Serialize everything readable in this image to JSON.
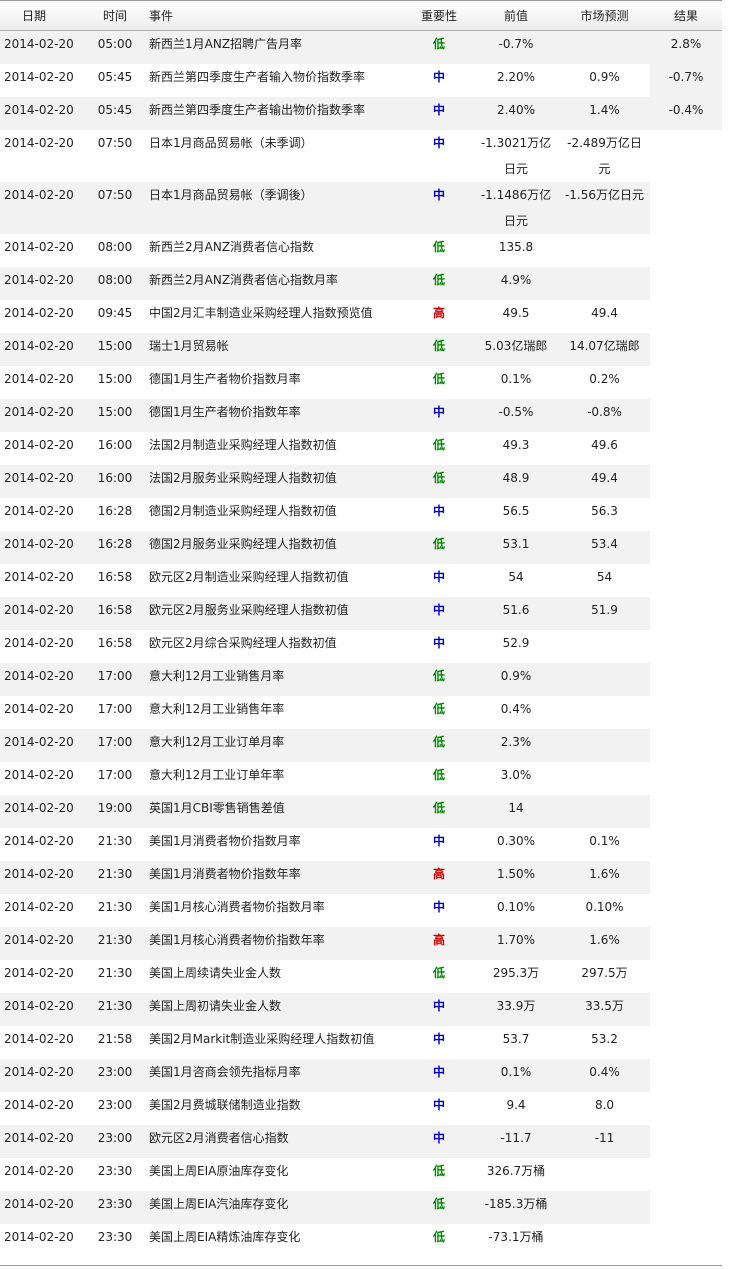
{
  "headers": {
    "date": "日期",
    "time": "时间",
    "event": "事件",
    "importance": "重要性",
    "previous": "前值",
    "forecast": "市场预测",
    "result": "结果"
  },
  "importance_colors": {
    "低": "#008800",
    "中": "#0000aa",
    "高": "#cc0000"
  },
  "rows": [
    {
      "date": "2014-02-20",
      "time": "05:00",
      "event": "新西兰1月ANZ招聘广告月率",
      "importance": "低",
      "previous": "-0.7%",
      "forecast": "",
      "result": "2.8%"
    },
    {
      "date": "2014-02-20",
      "time": "05:45",
      "event": "新西兰第四季度生产者输入物价指数季率",
      "importance": "中",
      "previous": "2.20%",
      "forecast": "0.9%",
      "result": "-0.7%"
    },
    {
      "date": "2014-02-20",
      "time": "05:45",
      "event": "新西兰第四季度生产者输出物价指数季率",
      "importance": "中",
      "previous": "2.40%",
      "forecast": "1.4%",
      "result": "-0.4%"
    },
    {
      "date": "2014-02-20",
      "time": "07:50",
      "event": "日本1月商品贸易帐（未季调）",
      "importance": "中",
      "previous": "-1.3021万亿日元",
      "forecast": "-2.489万亿日元",
      "result": ""
    },
    {
      "date": "2014-02-20",
      "time": "07:50",
      "event": "日本1月商品贸易帐（季调後）",
      "importance": "中",
      "previous": "-1.1486万亿日元",
      "forecast": "-1.56万亿日元",
      "result": ""
    },
    {
      "date": "2014-02-20",
      "time": "08:00",
      "event": "新西兰2月ANZ消费者信心指数",
      "importance": "低",
      "previous": "135.8",
      "forecast": "",
      "result": ""
    },
    {
      "date": "2014-02-20",
      "time": "08:00",
      "event": "新西兰2月ANZ消费者信心指数月率",
      "importance": "低",
      "previous": "4.9%",
      "forecast": "",
      "result": ""
    },
    {
      "date": "2014-02-20",
      "time": "09:45",
      "event": "中国2月汇丰制造业采购经理人指数预览值",
      "importance": "高",
      "previous": "49.5",
      "forecast": "49.4",
      "result": ""
    },
    {
      "date": "2014-02-20",
      "time": "15:00",
      "event": "瑞士1月贸易帐",
      "importance": "低",
      "previous": "5.03亿瑞郎",
      "forecast": "14.07亿瑞郎",
      "result": ""
    },
    {
      "date": "2014-02-20",
      "time": "15:00",
      "event": "德国1月生产者物价指数月率",
      "importance": "低",
      "previous": "0.1%",
      "forecast": "0.2%",
      "result": ""
    },
    {
      "date": "2014-02-20",
      "time": "15:00",
      "event": "德国1月生产者物价指数年率",
      "importance": "中",
      "previous": "-0.5%",
      "forecast": "-0.8%",
      "result": ""
    },
    {
      "date": "2014-02-20",
      "time": "16:00",
      "event": "法国2月制造业采购经理人指数初值",
      "importance": "低",
      "previous": "49.3",
      "forecast": "49.6",
      "result": ""
    },
    {
      "date": "2014-02-20",
      "time": "16:00",
      "event": "法国2月服务业采购经理人指数初值",
      "importance": "低",
      "previous": "48.9",
      "forecast": "49.4",
      "result": ""
    },
    {
      "date": "2014-02-20",
      "time": "16:28",
      "event": "德国2月制造业采购经理人指数初值",
      "importance": "中",
      "previous": "56.5",
      "forecast": "56.3",
      "result": ""
    },
    {
      "date": "2014-02-20",
      "time": "16:28",
      "event": "德国2月服务业采购经理人指数初值",
      "importance": "低",
      "previous": "53.1",
      "forecast": "53.4",
      "result": ""
    },
    {
      "date": "2014-02-20",
      "time": "16:58",
      "event": "欧元区2月制造业采购经理人指数初值",
      "importance": "中",
      "previous": "54",
      "forecast": "54",
      "result": ""
    },
    {
      "date": "2014-02-20",
      "time": "16:58",
      "event": "欧元区2月服务业采购经理人指数初值",
      "importance": "中",
      "previous": "51.6",
      "forecast": "51.9",
      "result": ""
    },
    {
      "date": "2014-02-20",
      "time": "16:58",
      "event": "欧元区2月综合采购经理人指数初值",
      "importance": "中",
      "previous": "52.9",
      "forecast": "",
      "result": ""
    },
    {
      "date": "2014-02-20",
      "time": "17:00",
      "event": "意大利12月工业销售月率",
      "importance": "低",
      "previous": "0.9%",
      "forecast": "",
      "result": ""
    },
    {
      "date": "2014-02-20",
      "time": "17:00",
      "event": "意大利12月工业销售年率",
      "importance": "低",
      "previous": "0.4%",
      "forecast": "",
      "result": ""
    },
    {
      "date": "2014-02-20",
      "time": "17:00",
      "event": "意大利12月工业订单月率",
      "importance": "低",
      "previous": "2.3%",
      "forecast": "",
      "result": ""
    },
    {
      "date": "2014-02-20",
      "time": "17:00",
      "event": "意大利12月工业订单年率",
      "importance": "低",
      "previous": "3.0%",
      "forecast": "",
      "result": ""
    },
    {
      "date": "2014-02-20",
      "time": "19:00",
      "event": "英国1月CBI零售销售差值",
      "importance": "低",
      "previous": "14",
      "forecast": "",
      "result": ""
    },
    {
      "date": "2014-02-20",
      "time": "21:30",
      "event": "美国1月消费者物价指数月率",
      "importance": "中",
      "previous": "0.30%",
      "forecast": "0.1%",
      "result": ""
    },
    {
      "date": "2014-02-20",
      "time": "21:30",
      "event": "美国1月消费者物价指数年率",
      "importance": "高",
      "previous": "1.50%",
      "forecast": "1.6%",
      "result": ""
    },
    {
      "date": "2014-02-20",
      "time": "21:30",
      "event": "美国1月核心消费者物价指数月率",
      "importance": "中",
      "previous": "0.10%",
      "forecast": "0.10%",
      "result": ""
    },
    {
      "date": "2014-02-20",
      "time": "21:30",
      "event": "美国1月核心消费者物价指数年率",
      "importance": "高",
      "previous": "1.70%",
      "forecast": "1.6%",
      "result": ""
    },
    {
      "date": "2014-02-20",
      "time": "21:30",
      "event": "美国上周续请失业金人数",
      "importance": "低",
      "previous": "295.3万",
      "forecast": "297.5万",
      "result": ""
    },
    {
      "date": "2014-02-20",
      "time": "21:30",
      "event": "美国上周初请失业金人数",
      "importance": "中",
      "previous": "33.9万",
      "forecast": "33.5万",
      "result": ""
    },
    {
      "date": "2014-02-20",
      "time": "21:58",
      "event": "美国2月Markit制造业采购经理人指数初值",
      "importance": "中",
      "previous": "53.7",
      "forecast": "53.2",
      "result": ""
    },
    {
      "date": "2014-02-20",
      "time": "23:00",
      "event": "美国1月咨商会领先指标月率",
      "importance": "中",
      "previous": "0.1%",
      "forecast": "0.4%",
      "result": ""
    },
    {
      "date": "2014-02-20",
      "time": "23:00",
      "event": "美国2月费城联储制造业指数",
      "importance": "中",
      "previous": "9.4",
      "forecast": "8.0",
      "result": ""
    },
    {
      "date": "2014-02-20",
      "time": "23:00",
      "event": "欧元区2月消费者信心指数",
      "importance": "中",
      "previous": "-11.7",
      "forecast": "-11",
      "result": ""
    },
    {
      "date": "2014-02-20",
      "time": "23:30",
      "event": "美国上周EIA原油库存变化",
      "importance": "低",
      "previous": "326.7万桶",
      "forecast": "",
      "result": ""
    },
    {
      "date": "2014-02-20",
      "time": "23:30",
      "event": "美国上周EIA汽油库存变化",
      "importance": "低",
      "previous": "-185.3万桶",
      "forecast": "",
      "result": ""
    },
    {
      "date": "2014-02-20",
      "time": "23:30",
      "event": "美国上周EIA精炼油库存变化",
      "importance": "低",
      "previous": "-73.1万桶",
      "forecast": "",
      "result": ""
    }
  ]
}
